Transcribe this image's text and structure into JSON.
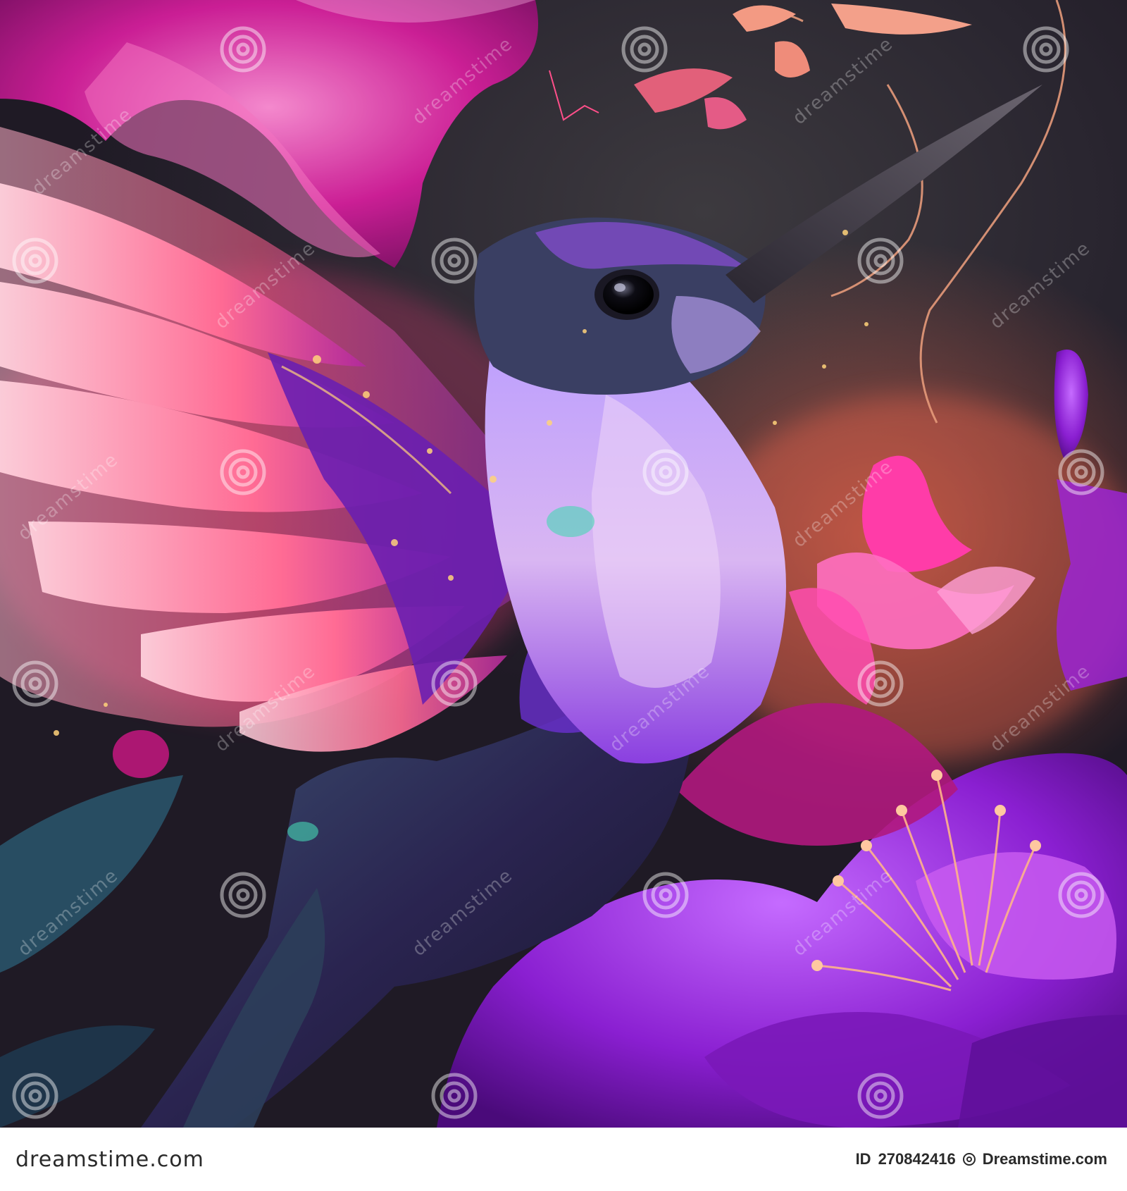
{
  "image": {
    "subject": "iridescent-hummingbird-among-magenta-flowers",
    "palette": {
      "magenta": "#e0209a",
      "violet": "#8a2be2",
      "pink_glow": "#ff7aa8",
      "orange_glow": "#ff7a50",
      "background": "#2e2a33"
    }
  },
  "watermark": {
    "text": "dreamstime"
  },
  "footer": {
    "brand": "dreamstime.com",
    "id_label": "ID",
    "id_value": "270842416",
    "credit": "Dreamstime.com"
  }
}
